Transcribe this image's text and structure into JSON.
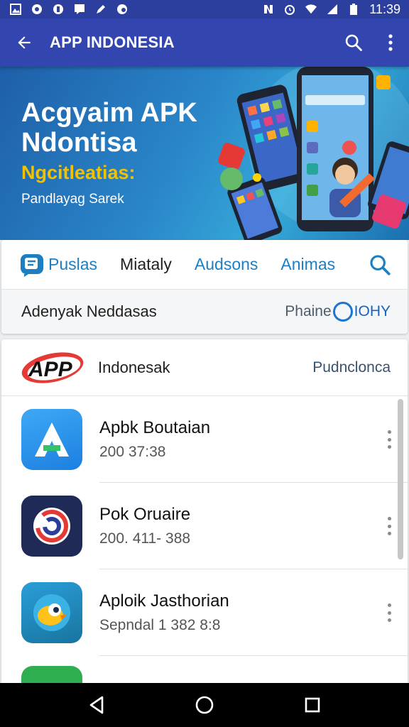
{
  "status_bar": {
    "time": "11:39",
    "left_icons": [
      "gallery-icon",
      "location-icon",
      "notification-icon",
      "chat-icon",
      "pen-icon",
      "cloud-icon"
    ],
    "right_icons": [
      "nfc-icon",
      "alarm-icon",
      "wifi-icon",
      "signal-icon",
      "battery-icon"
    ]
  },
  "app_bar": {
    "title": "APP INDONESIA",
    "background": "#3346b0"
  },
  "banner": {
    "title": "Acgyaim APK\nNdontisa",
    "subtitle": "Ngcitleatias:",
    "caption": "Pandlayag Sarek"
  },
  "tabs": {
    "items": [
      {
        "label": "Puslas",
        "active": true
      },
      {
        "label": "Miataly",
        "active": false
      },
      {
        "label": "Audsons",
        "active": false
      },
      {
        "label": "Animas",
        "active": false
      }
    ]
  },
  "filter": {
    "label": "Adenyak Neddasas",
    "right_prefix": "Phaine",
    "right_suffix": "IOHY"
  },
  "list_header": {
    "logo_text": "APP",
    "title": "Indonesak",
    "right": "Pudnclonca"
  },
  "apps": [
    {
      "name": "Apbk Boutaian",
      "meta": "200  37:38",
      "icon": "letter-a-icon"
    },
    {
      "name": "Pok Oruaire",
      "meta": "200. 411- 388",
      "icon": "swirl-logo-icon"
    },
    {
      "name": "Aploik Jasthorian",
      "meta": "Sepndal 1 382 8:8",
      "icon": "bird-mascot-icon"
    }
  ],
  "colors": {
    "accent": "#3346b0",
    "status_bar": "#2d3f9e",
    "tab_blue": "#1d7fc2",
    "subtitle_yellow": "#f2c200"
  }
}
